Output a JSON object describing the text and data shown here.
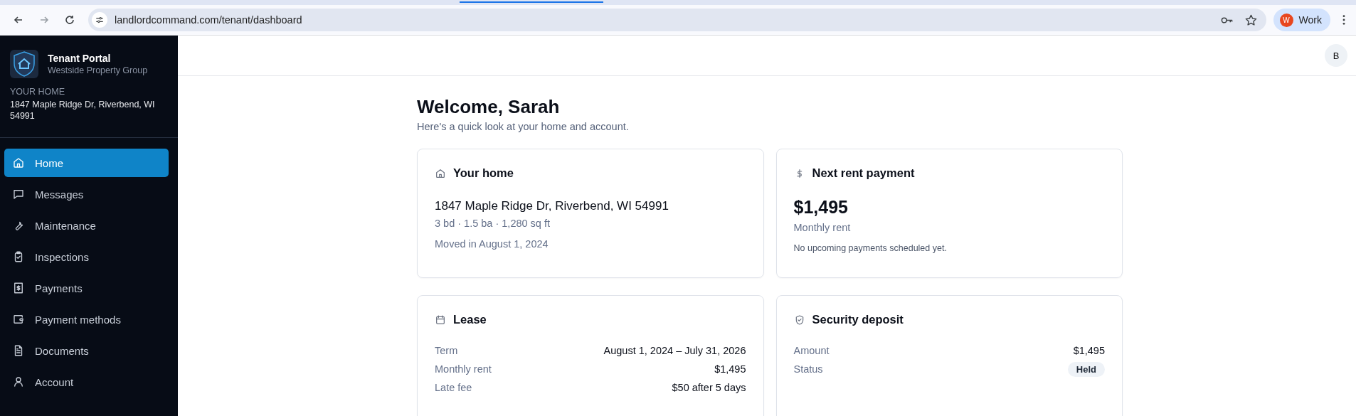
{
  "browser": {
    "url": "landlordcommand.com/tenant/dashboard",
    "profile": {
      "initial": "W",
      "label": "Work"
    }
  },
  "sidebar": {
    "app_title": "Tenant Portal",
    "company": "Westside Property Group",
    "home_label": "YOUR HOME",
    "home_address": "1847 Maple Ridge Dr, Riverbend, WI 54991",
    "items": [
      {
        "label": "Home",
        "kind": "home",
        "selected": true
      },
      {
        "label": "Messages",
        "kind": "message",
        "selected": false
      },
      {
        "label": "Maintenance",
        "kind": "wrench",
        "selected": false
      },
      {
        "label": "Inspections",
        "kind": "clipboard",
        "selected": false
      },
      {
        "label": "Payments",
        "kind": "receipt",
        "selected": false
      },
      {
        "label": "Payment methods",
        "kind": "wallet",
        "selected": false
      },
      {
        "label": "Documents",
        "kind": "document",
        "selected": false
      },
      {
        "label": "Account",
        "kind": "user",
        "selected": false
      }
    ]
  },
  "topbar": {
    "avatar": "B"
  },
  "welcome": {
    "title": "Welcome, Sarah",
    "subtitle": "Here's a quick look at your home and account."
  },
  "cards": [
    {
      "kind": "home",
      "title": "Your home",
      "address": "1847 Maple Ridge Dr, Riverbend, WI 54991",
      "details": "3 bd · 1.5 ba · 1,280 sq ft",
      "moved_in": "Moved in August 1, 2024"
    },
    {
      "kind": "rent",
      "title": "Next rent payment",
      "amount": "$1,495",
      "amount_label": "Monthly rent",
      "note": "No upcoming payments scheduled yet."
    },
    {
      "kind": "lease",
      "title": "Lease",
      "rows": [
        {
          "label": "Term",
          "value": "August 1, 2024 – July 31, 2026",
          "kind": "text"
        },
        {
          "label": "Monthly rent",
          "value": "$1,495",
          "kind": "text"
        },
        {
          "label": "Late fee",
          "value": "$50 after 5 days",
          "kind": "text"
        }
      ]
    },
    {
      "kind": "deposit",
      "title": "Security deposit",
      "rows": [
        {
          "label": "Amount",
          "value": "$1,495",
          "kind": "text"
        },
        {
          "label": "Status",
          "value": "Held",
          "kind": "badge"
        }
      ]
    }
  ]
}
